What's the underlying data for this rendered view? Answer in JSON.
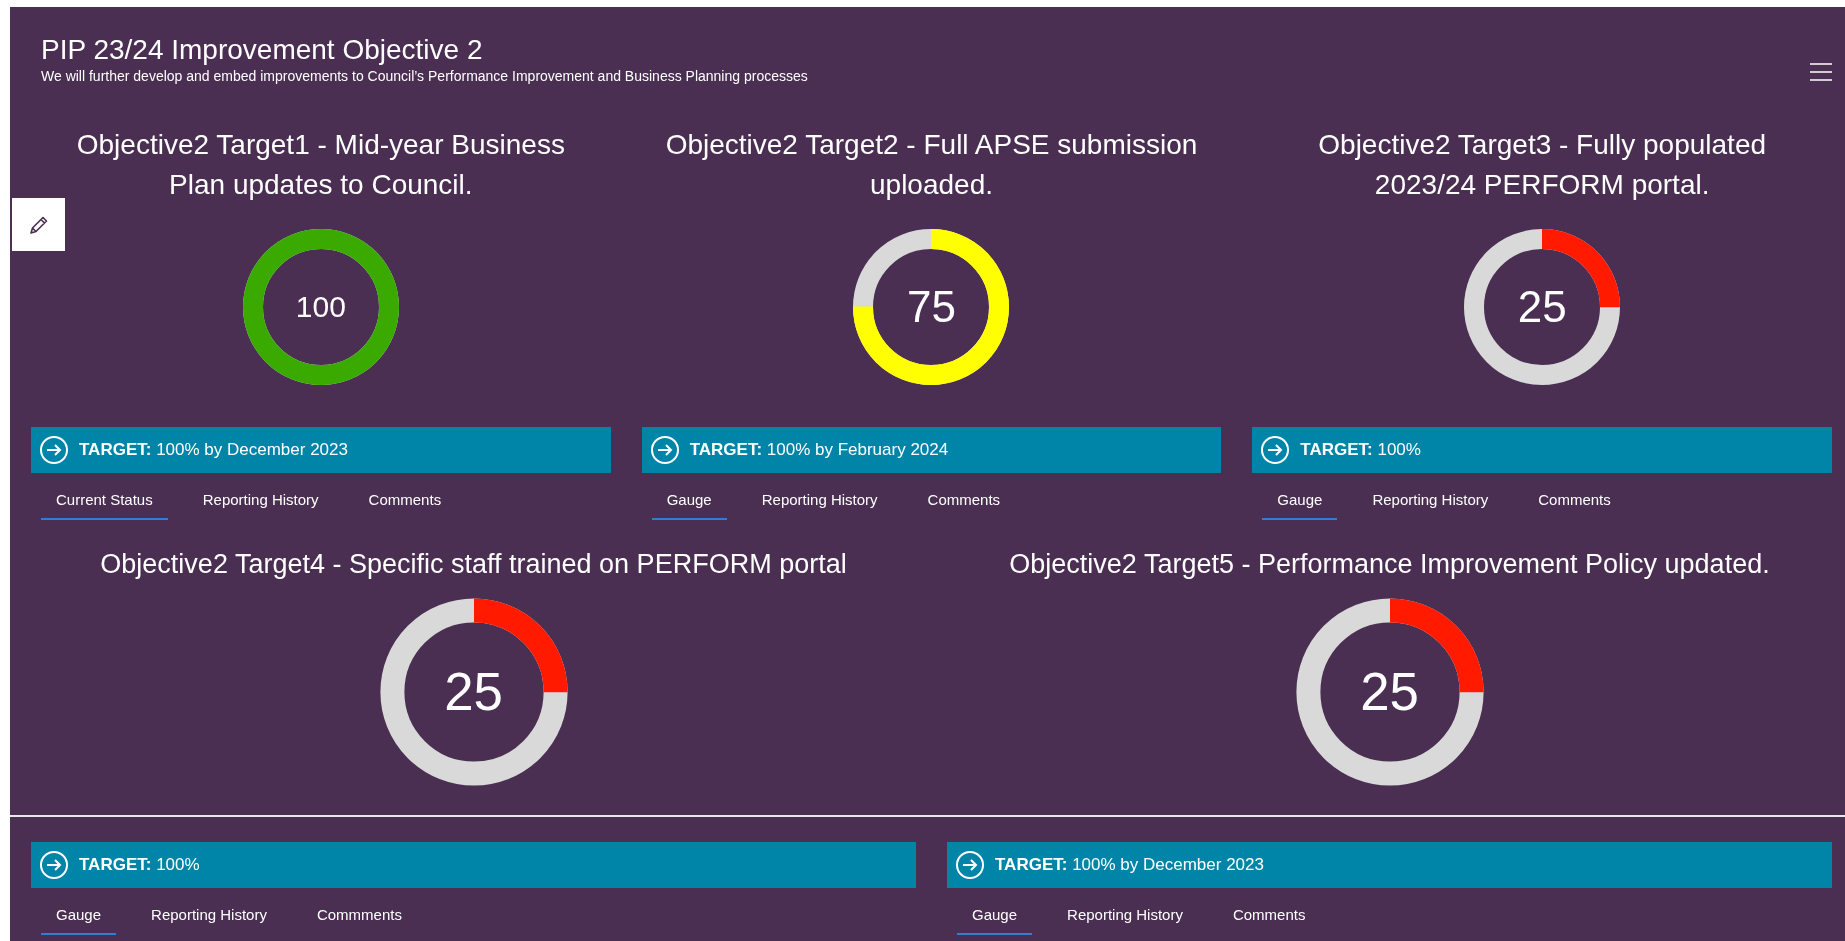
{
  "header": {
    "title": "PIP 23/24 Improvement Objective 2",
    "subtitle": "We will further develop and embed improvements to Council’s Performance Improvement and Business Planning processes"
  },
  "cards": [
    {
      "title": "Objective2 Target1 - Mid-year Business Plan updates to Council.",
      "gauge": {
        "value": "100",
        "color": "#3aaa00"
      },
      "target": {
        "label": "TARGET:",
        "text": "100% by December 2023"
      },
      "tabs": [
        {
          "label": "Current Status",
          "selected": true
        },
        {
          "label": "Reporting History",
          "selected": false
        },
        {
          "label": "Comments",
          "selected": false
        }
      ]
    },
    {
      "title": "Objective2 Target2 - Full APSE submission uploaded.",
      "gauge": {
        "value": "75",
        "color": "#ffff00"
      },
      "target": {
        "label": "TARGET:",
        "text": "100% by February 2024"
      },
      "tabs": [
        {
          "label": "Gauge",
          "selected": true
        },
        {
          "label": "Reporting History",
          "selected": false
        },
        {
          "label": "Comments",
          "selected": false
        }
      ]
    },
    {
      "title": "Objective2 Target3 - Fully populated 2023/24 PERFORM portal.",
      "gauge": {
        "value": "25",
        "color": "#ff1a00"
      },
      "target": {
        "label": "TARGET:",
        "text": "100%"
      },
      "tabs": [
        {
          "label": "Gauge",
          "selected": true
        },
        {
          "label": "Reporting History",
          "selected": false
        },
        {
          "label": "Comments",
          "selected": false
        }
      ]
    },
    {
      "title": "Objective2 Target4 - Specific staff trained on PERFORM portal",
      "gauge": {
        "value": "25",
        "color": "#ff1a00"
      },
      "target": {
        "label": "TARGET:",
        "text": "100%"
      },
      "tabs": [
        {
          "label": "Gauge",
          "selected": true
        },
        {
          "label": "Reporting History",
          "selected": false
        },
        {
          "label": "Commments",
          "selected": false
        }
      ]
    },
    {
      "title": "Objective2 Target5 - Performance Improvement Policy updated.",
      "gauge": {
        "value": "25",
        "color": "#ff1a00"
      },
      "target": {
        "label": "TARGET:",
        "text": "100% by December 2023"
      },
      "tabs": [
        {
          "label": "Gauge",
          "selected": true
        },
        {
          "label": "Reporting History",
          "selected": false
        },
        {
          "label": "Comments",
          "selected": false
        }
      ]
    }
  ]
}
